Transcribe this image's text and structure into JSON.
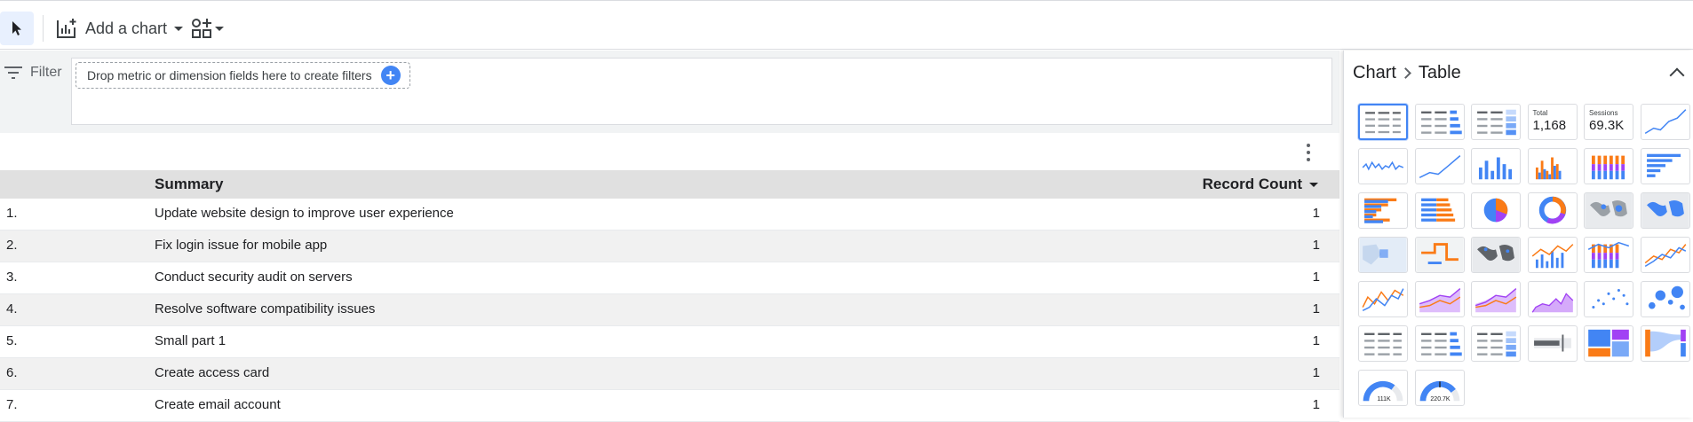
{
  "toolbar": {
    "select_tool": "select-icon",
    "add_chart_label": "Add a chart",
    "add_controls": "add-controls-icon"
  },
  "filter": {
    "label": "Filter",
    "drop_hint": "Drop metric or dimension fields here to create filters",
    "add": "+"
  },
  "table": {
    "columns": {
      "summary": "Summary",
      "count": "Record Count"
    },
    "rows": [
      {
        "num": "1.",
        "summary": "Update website design to improve user experience",
        "count": "1"
      },
      {
        "num": "2.",
        "summary": "Fix login issue for mobile app",
        "count": "1"
      },
      {
        "num": "3.",
        "summary": "Conduct security audit on servers",
        "count": "1"
      },
      {
        "num": "4.",
        "summary": "Resolve software compatibility issues",
        "count": "1"
      },
      {
        "num": "5.",
        "summary": "Small part 1",
        "count": "1"
      },
      {
        "num": "6.",
        "summary": "Create access card",
        "count": "1"
      },
      {
        "num": "7.",
        "summary": "Create email account",
        "count": "1"
      }
    ]
  },
  "panel": {
    "breadcrumb_root": "Chart",
    "breadcrumb_current": "Table",
    "scorecards": [
      {
        "label": "Total",
        "value": "1,168"
      },
      {
        "label": "Sessions",
        "value": "69.3K"
      }
    ],
    "gauges": [
      "111K",
      "220.7K"
    ],
    "colors": {
      "blue": "#4285f4",
      "orange": "#fa7b17",
      "purple": "#a142f4",
      "selected": "#4285f4"
    }
  }
}
